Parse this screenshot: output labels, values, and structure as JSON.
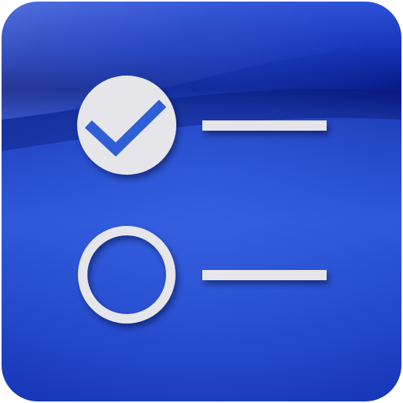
{
  "app_icon": {
    "icon_name": "checklist-icon",
    "colors": {
      "background_dark": "#0a1a8c",
      "background_mid": "#1f3fbf",
      "background_light": "#2a55d8",
      "foreground": "#e6e6ea",
      "check_mark": "#2f5fd6"
    },
    "items": [
      {
        "icon_name": "checked-circle-icon",
        "state": "checked"
      },
      {
        "icon_name": "empty-circle-icon",
        "state": "unchecked"
      }
    ]
  }
}
